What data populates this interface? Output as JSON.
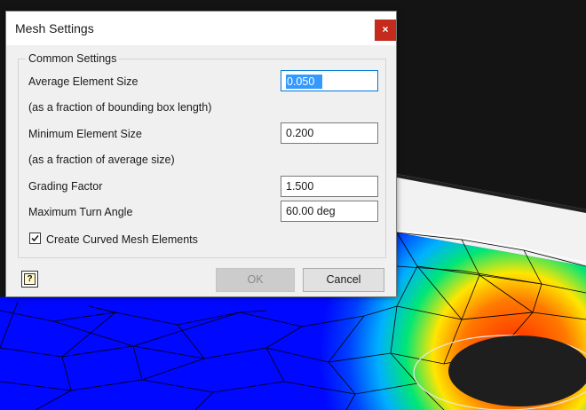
{
  "dialog": {
    "title": "Mesh Settings",
    "close_label": "×",
    "group_title": "Common Settings",
    "fields": {
      "avg_element_size": {
        "label": "Average Element Size",
        "value": "0.050",
        "selected_text": "0.050"
      },
      "avg_note": "(as a fraction of bounding box length)",
      "min_element_size": {
        "label": "Minimum Element Size",
        "value": "0.200"
      },
      "min_note": "(as a fraction of average size)",
      "grading_factor": {
        "label": "Grading Factor",
        "value": "1.500"
      },
      "max_turn_angle": {
        "label": "Maximum Turn Angle",
        "value": "60.00 deg"
      }
    },
    "curved_mesh": {
      "label": "Create Curved Mesh Elements",
      "checked": true
    },
    "help_icon_glyph": "?",
    "buttons": {
      "ok": "OK",
      "cancel": "Cancel",
      "ok_enabled": false
    }
  },
  "colors": {
    "close": "#c42b1c",
    "selection": "#3399ff",
    "mesh_blue": "#0008ff",
    "mesh_red": "#ff1e00",
    "mesh_green": "#00e676",
    "mesh_yellow": "#ffe600",
    "background_dark": "#141414"
  }
}
